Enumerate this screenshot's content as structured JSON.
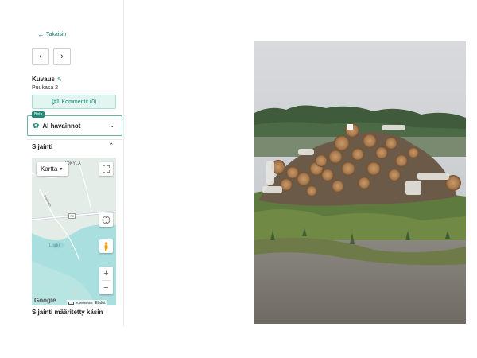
{
  "nav": {
    "back_label": "Takaisin"
  },
  "description": {
    "title": "Kuvaus",
    "text": "Puukasa 2"
  },
  "comments": {
    "label": "Kommentit (0)"
  },
  "ai": {
    "badge": "Beta",
    "label": "AI havainnot"
  },
  "location": {
    "title": "Sijainti",
    "manual_text": "Sijainti määritetty käsin"
  },
  "map": {
    "type_label": "Kartta",
    "place_label_1": "IOKYLÄ",
    "place_label_2": "Lilaki",
    "road_label": "Ontinen",
    "road_number": "73",
    "brand": "Google",
    "footer_data": "Karttatiedot",
    "footer_terms": "Ehdot"
  },
  "colors": {
    "accent": "#1a8a7a",
    "accent_light": "#e2f5f1",
    "map_water": "#aadfe0",
    "map_land": "#dfe9e4"
  }
}
